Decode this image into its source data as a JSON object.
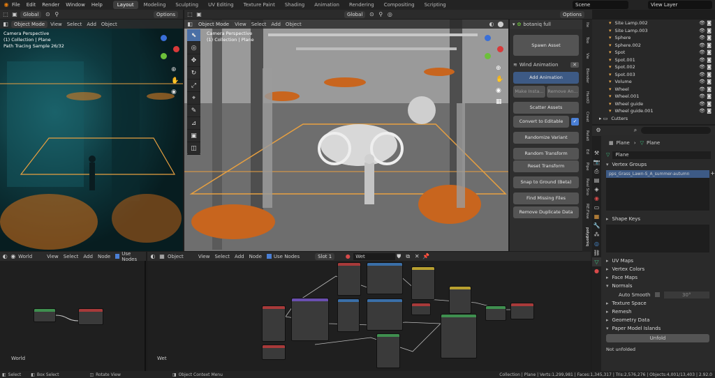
{
  "topbar": {
    "menus": [
      "File",
      "Edit",
      "Render",
      "Window",
      "Help"
    ],
    "workspaces": [
      "Layout",
      "Modeling",
      "Sculpting",
      "UV Editing",
      "Texture Paint",
      "Shading",
      "Animation",
      "Rendering",
      "Compositing",
      "Scripting"
    ],
    "active_workspace": "Layout",
    "scene": "Scene",
    "view_layer": "View Layer"
  },
  "vp1": {
    "header": {
      "transform": "Global",
      "options": "Options",
      "mode": "Object Mode",
      "menus": [
        "View",
        "Select",
        "Add",
        "Object"
      ]
    },
    "overlay_title": "Camera Perspective",
    "overlay_collection": "(1) Collection | Plane",
    "overlay_sample": "Path Tracing Sample 26/32"
  },
  "vp2": {
    "header": {
      "transform": "Global",
      "options": "Options",
      "mode": "Object Mode",
      "menus": [
        "View",
        "Select",
        "Add",
        "Object"
      ]
    },
    "overlay_title": "Camera Perspective",
    "overlay_collection": "(1) Collection | Plane"
  },
  "botaniq": {
    "title": "botaniq full",
    "spawn": "Spawn Asset",
    "wind": "Wind Animation",
    "add_anim": "Add Animation",
    "make_inst": "Make Insta...",
    "remove_an": "Remove An...",
    "scatter": "Scatter Assets",
    "convert": "Convert to Editable",
    "randomize": "Randomize Variant",
    "random_transform": "Random Transform",
    "reset_transform": "Reset Transform",
    "snap": "Snap to Ground (Beta)",
    "find_missing": "Find Missing Files",
    "remove_dup": "Remove Duplicate Data",
    "side_tabs": [
      "Ite",
      "Too",
      "Vie",
      "Blender",
      "HardO",
      "Creat",
      "Relati",
      "Ed",
      "Pipe",
      "Real Sno",
      "RE:Flow",
      "polygoniq"
    ]
  },
  "outliner": {
    "items": [
      "Site Lamp.002",
      "Site Lamp.003",
      "Sphere",
      "Sphere.002",
      "Spot",
      "Spot.001",
      "Spot.002",
      "Spot.003",
      "Volume",
      "Wheel",
      "Wheel.001",
      "Wheel guide",
      "Wheel guide.001",
      "Cutters"
    ]
  },
  "properties": {
    "breadcrumb_obj": "Plane",
    "breadcrumb_mesh": "Plane",
    "mesh_name": "Plane",
    "vertex_groups": "Vertex Groups",
    "vg_item": "pps_Grass_Lawn-S_A_summer-autumn",
    "shape_keys": "Shape Keys",
    "uv_maps": "UV Maps",
    "vertex_colors": "Vertex Colors",
    "face_maps": "Face Maps",
    "normals": "Normals",
    "auto_smooth": "Auto Smooth",
    "auto_smooth_angle": "30°",
    "texture_space": "Texture Space",
    "remesh": "Remesh",
    "geometry_data": "Geometry Data",
    "paper_model": "Paper Model Islands",
    "unfold": "Unfold",
    "not_unfolded": "Not unfolded"
  },
  "ne1": {
    "menus": [
      "View",
      "Select",
      "Add",
      "Node"
    ],
    "world_label": "World",
    "use_nodes": "Use Nodes",
    "corner": "World"
  },
  "ne2": {
    "menus": [
      "View",
      "Select",
      "Add",
      "Node"
    ],
    "object_label": "Object",
    "use_nodes": "Use Nodes",
    "slot": "Slot 1",
    "material": "Wet",
    "corner": "Wet"
  },
  "status": {
    "select": "Select",
    "box_select": "Box Select",
    "rotate_view": "Rotate View",
    "context_menu": "Object Context Menu",
    "stats": "Collection | Plane | Verts:1,299,981 | Faces:1,345,317 | Tris:2,576,276 | Objects:4,001/13,403 | 2.92.0"
  },
  "colors": {
    "accent": "#4a6fa5",
    "selection_orange": "#e8a040",
    "mesh_green": "#3fbf7f"
  }
}
